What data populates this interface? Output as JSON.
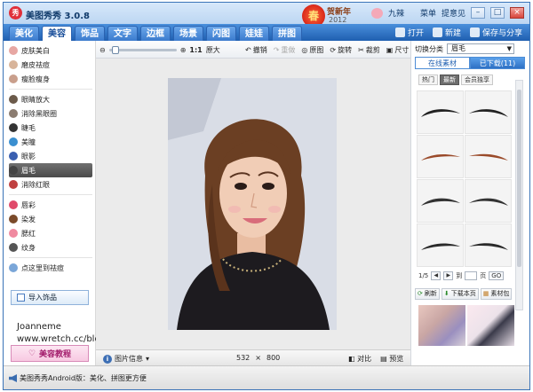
{
  "app": {
    "title": "美图秀秀 3.0.8",
    "logo_glyph": "秀"
  },
  "festive": {
    "glyph": "春",
    "text": "贺新年",
    "year": "2012"
  },
  "titlebar": {
    "user": "九辣",
    "menu": "菜单",
    "feedback": "提意见",
    "min": "–",
    "max": "□",
    "close": "×"
  },
  "tabs": [
    "美化",
    "美容",
    "饰品",
    "文字",
    "边框",
    "场景",
    "闪图",
    "娃娃",
    "拼图"
  ],
  "active_tab": 1,
  "top_actions": {
    "open": "打开",
    "new": "新建",
    "save_share": "保存与分享"
  },
  "sidebar": {
    "group1": [
      {
        "label": "皮肤美白",
        "color": "#e7a7a3"
      },
      {
        "label": "磨皮祛痘",
        "color": "#d8b49a"
      },
      {
        "label": "瘦脸瘦身",
        "color": "#c99f8c"
      }
    ],
    "group2": [
      {
        "label": "眼睛放大",
        "color": "#6b5a4a"
      },
      {
        "label": "消除黑眼圈",
        "color": "#8b7c70"
      },
      {
        "label": "睫毛",
        "color": "#333333"
      },
      {
        "label": "美瞳",
        "color": "#3a8fd0"
      },
      {
        "label": "眼影",
        "color": "#3a5fb0"
      },
      {
        "label": "眉毛",
        "color": "#444444",
        "active": true
      },
      {
        "label": "消除红眼",
        "color": "#c04040"
      }
    ],
    "group3": [
      {
        "label": "唇彩",
        "color": "#e04a6a"
      },
      {
        "label": "染发",
        "color": "#7a4a2a"
      },
      {
        "label": "腮红",
        "color": "#f08aa0"
      },
      {
        "label": "纹身",
        "color": "#555555"
      }
    ],
    "point_remove": "点这里到祛痘",
    "import_label": "导入饰品",
    "tutorial_label": "美容教程"
  },
  "credit": {
    "line1": "Joanneme",
    "line2": "www.wretch.cc/blog/joanneme"
  },
  "toolbar": {
    "zoom_ratio": "1:1",
    "original": "原大",
    "zoom_value": 0.05,
    "undo": "撤销",
    "redo": "重做",
    "original_img": "原图",
    "rotate": "旋转",
    "crop": "裁剪",
    "size": "尺寸"
  },
  "status": {
    "image_info": "图片信息",
    "width": "532",
    "times": "×",
    "height": "800",
    "compare": "对比",
    "preview": "预览"
  },
  "right_panel": {
    "category_label": "切换分类",
    "category_value": "眉毛",
    "online_tab": "在线素材",
    "downloaded_tab": "已下载(11)",
    "sub_tabs": [
      "热门",
      "最新",
      "会员独享"
    ],
    "active_sub_tab": 1,
    "page": {
      "current": "1/5",
      "jump": "到",
      "page_unit": "页",
      "go": "GO"
    },
    "buttons": {
      "refresh": "刷新",
      "download_page": "下载本页",
      "pack": "素材包"
    }
  },
  "bottom": {
    "message": "美图秀秀Android版：美化、拼图更方便"
  }
}
